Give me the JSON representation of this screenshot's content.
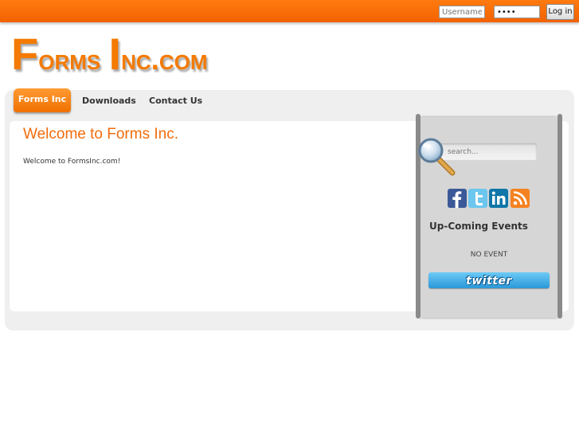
{
  "login": {
    "username_placeholder": "Username",
    "password_value": "••••",
    "login_label": "Log in"
  },
  "logo": {
    "part1_initial": "F",
    "part1_rest": "orms ",
    "part2_initial": "I",
    "part2_rest": "nc.com"
  },
  "nav": {
    "tabs": [
      {
        "label": "Forms Inc",
        "active": true
      },
      {
        "label": "Downloads",
        "active": false
      },
      {
        "label": "Contact Us",
        "active": false
      }
    ]
  },
  "main": {
    "title": "Welcome to Forms Inc.",
    "body": "Welcome to FormsInc.com!"
  },
  "sidebar": {
    "search_placeholder": "search...",
    "social_icons": [
      "facebook-icon",
      "twitter-icon",
      "linkedin-icon",
      "rss-icon"
    ],
    "events_heading": "Up-Coming Events",
    "no_event_text": "NO EVENT",
    "twitter_label": "twitter"
  },
  "colors": {
    "accent_orange": "#f26200",
    "title_orange": "#f26c0c",
    "twitter_blue": "#2a98d8"
  }
}
